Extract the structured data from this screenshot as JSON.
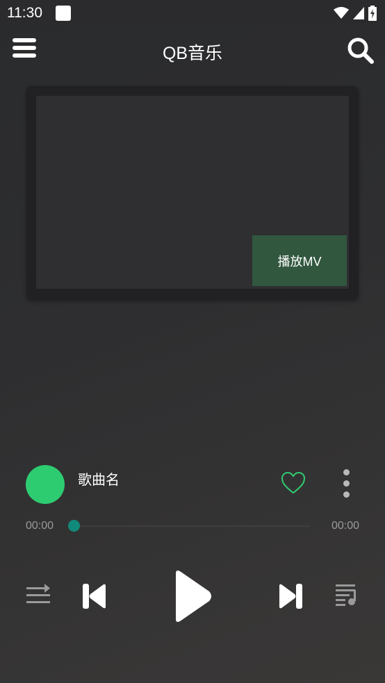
{
  "status_bar": {
    "time": "11:30"
  },
  "app_bar": {
    "title": "QB音乐",
    "menu_icon": "menu-icon",
    "search_icon": "search-icon"
  },
  "mv": {
    "play_label": "播放MV"
  },
  "song": {
    "name": "歌曲名",
    "liked": false
  },
  "progress": {
    "current": "00:00",
    "total": "00:00",
    "fraction": 0
  },
  "controls": {
    "order_icon": "play-order-icon",
    "prev_icon": "previous-icon",
    "play_icon": "play-icon",
    "next_icon": "next-icon",
    "playlist_icon": "playlist-icon"
  },
  "colors": {
    "accent": "#2ecc71",
    "mv_button": "#31573f",
    "progress_thumb": "#118a7a"
  }
}
